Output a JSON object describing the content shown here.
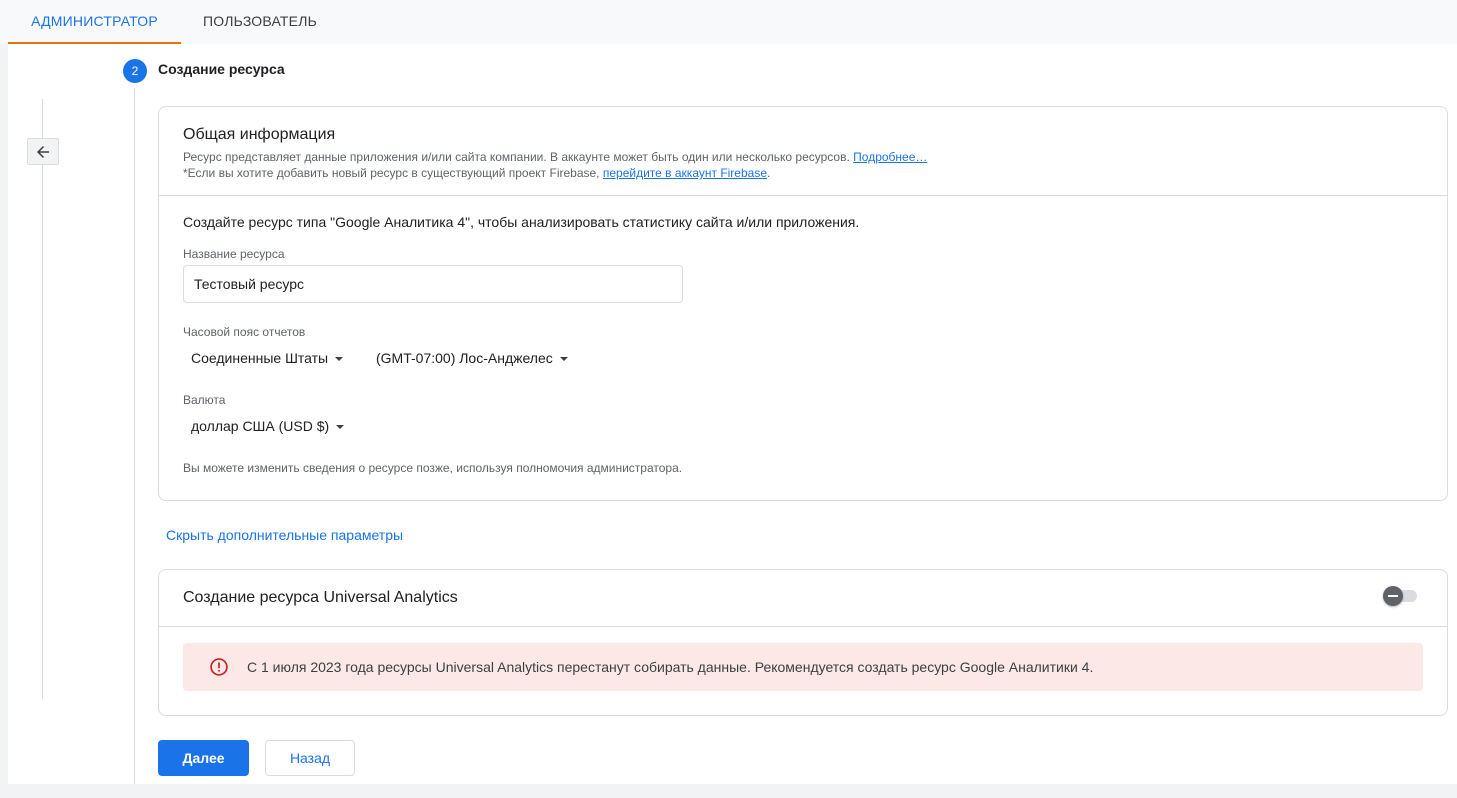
{
  "tabs": [
    {
      "label": "АДМИНИСТРАТОР",
      "active": true
    },
    {
      "label": "ПОЛЬЗОВАТЕЛЬ",
      "active": false
    }
  ],
  "step": {
    "number": "2",
    "title": "Создание ресурса"
  },
  "general": {
    "title": "Общая информация",
    "desc1": "Ресурс представляет данные приложения и/или сайта компании. В аккаунте может быть один или несколько ресурсов.",
    "learn_more": "Подробнее…",
    "desc2": "*Если вы хотите добавить новый ресурс в существующий проект Firebase,",
    "firebase_link": "перейдите в аккаунт Firebase",
    "desc2_end": ".",
    "intro": "Создайте ресурс типа \"Google Аналитика 4\", чтобы анализировать статистику сайта и/или приложения.",
    "name_label": "Название ресурса",
    "name_value": "Тестовый ресурс",
    "timezone_label": "Часовой пояс отчетов",
    "country": "Соединенные Штаты",
    "timezone": "(GMT-07:00) Лос-Анджелес",
    "currency_label": "Валюта",
    "currency": "доллар США (USD $)",
    "note": "Вы можете изменить сведения о ресурсе позже, используя полномочия администратора."
  },
  "hide_advanced": "Скрыть дополнительные параметры",
  "ua": {
    "title": "Создание ресурса Universal Analytics",
    "toggle_on": false,
    "alert": "С 1 июля 2023 года ресурсы Universal Analytics перестанут собирать данные. Рекомендуется создать ресурс Google Аналитики 4."
  },
  "buttons": {
    "next": "Далее",
    "back": "Назад"
  },
  "colors": {
    "accent": "#1a73e8",
    "tab_indicator": "#e8710a",
    "alert_bg": "#fce8e6",
    "alert_icon": "#c5221f"
  }
}
